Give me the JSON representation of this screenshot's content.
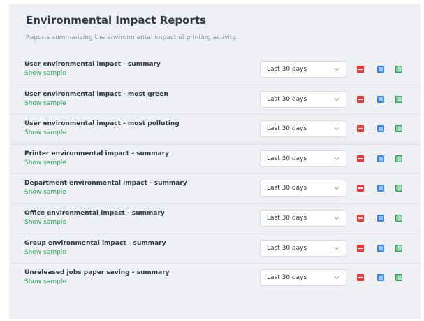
{
  "header": {
    "title": "Environmental Impact Reports",
    "subtitle": "Reports summarizing the environmental impact of printing activity."
  },
  "colors": {
    "link": "#26a65b",
    "pdf": "#e03a3a",
    "doc": "#3b87e0",
    "spreadsheet": "#1fa352"
  },
  "icons": {
    "pdf": "pdf-icon",
    "doc": "document-icon",
    "spreadsheet": "spreadsheet-icon",
    "dropdown": "chevron-down-icon"
  },
  "reports": [
    {
      "name": "User environmental impact - summary",
      "link": "Show sample",
      "period": "Last 30 days"
    },
    {
      "name": "User environmental impact - most green",
      "link": "Show sample",
      "period": "Last 30 days"
    },
    {
      "name": "User environmental impact - most polluting",
      "link": "Show sample",
      "period": "Last 30 days"
    },
    {
      "name": "Printer environmental impact - summary",
      "link": "Show sample",
      "period": "Last 30 days"
    },
    {
      "name": "Department environmental impact - summary",
      "link": "Show sample",
      "period": "Last 30 days"
    },
    {
      "name": "Office environmental impact - summary",
      "link": "Show sample",
      "period": "Last 30 days"
    },
    {
      "name": "Group environmental impact - summary",
      "link": "Show sample",
      "period": "Last 30 days"
    },
    {
      "name": "Unreleased jobs paper saving - summary",
      "link": "Show sample",
      "period": "Last 30 days"
    }
  ]
}
